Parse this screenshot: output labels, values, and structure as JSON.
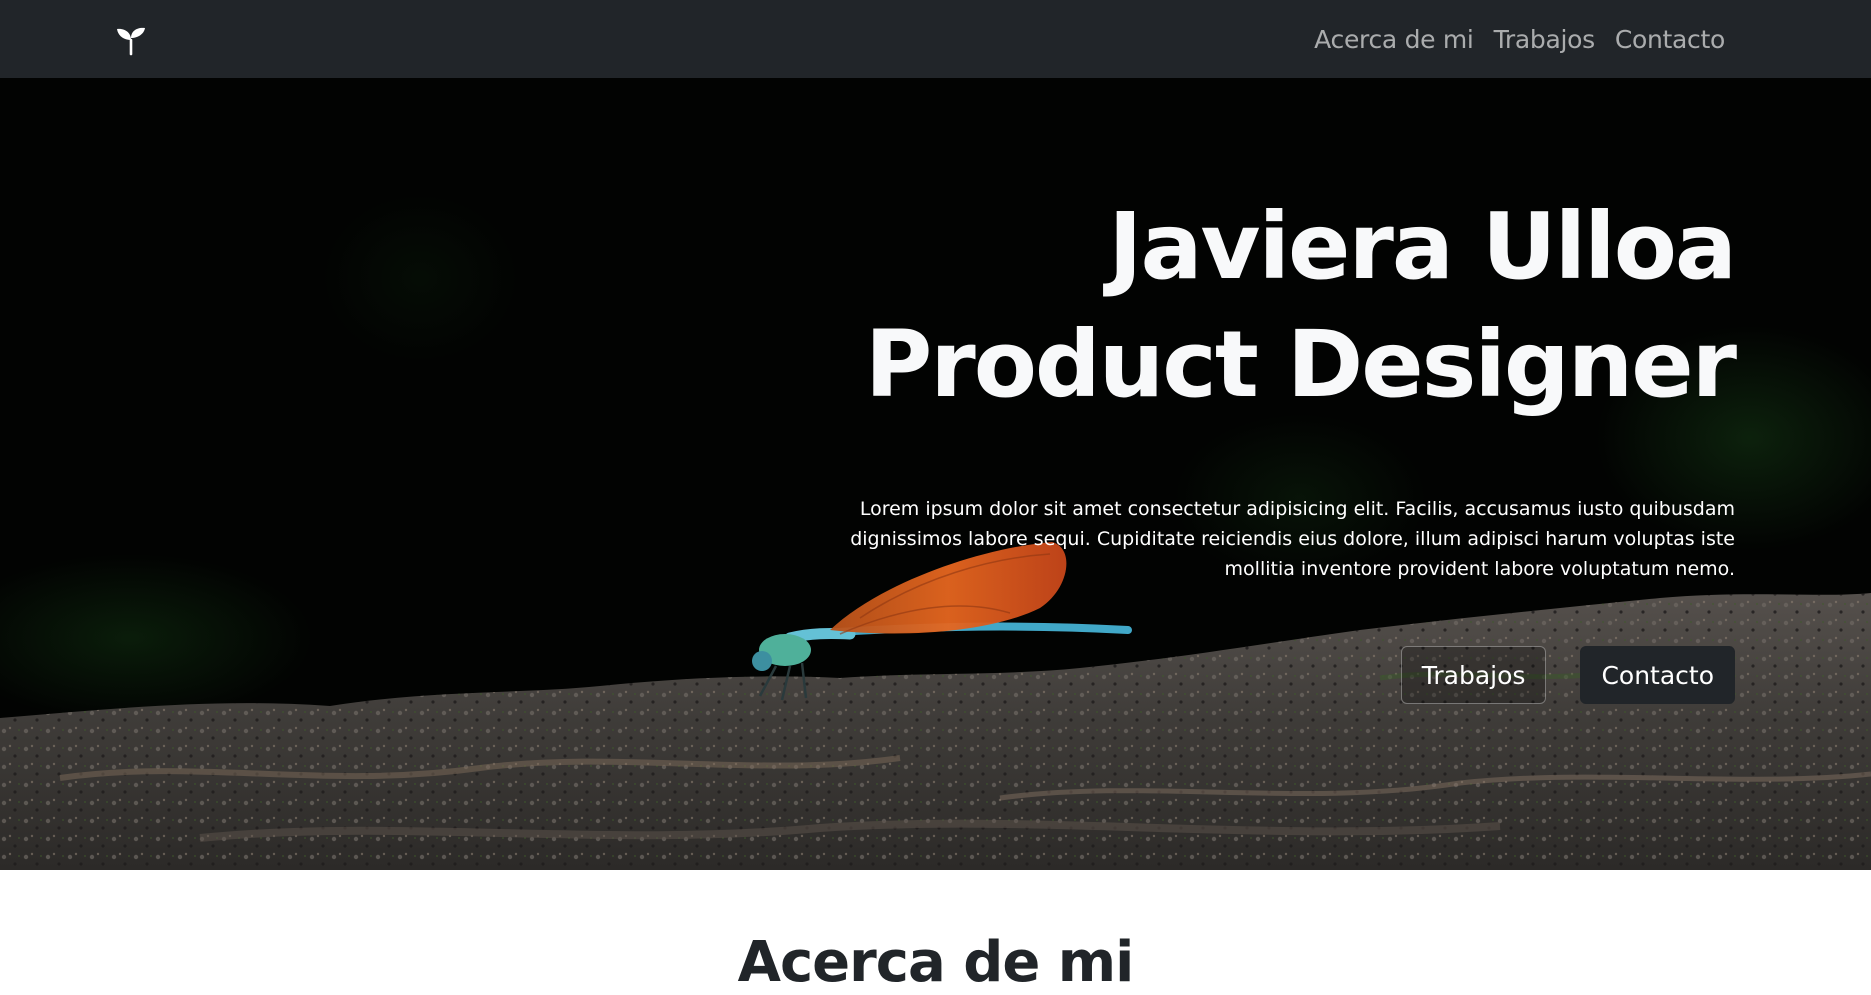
{
  "nav": {
    "brand_icon": "sprout-icon",
    "links": [
      "Acerca de mi",
      "Trabajos",
      "Contacto"
    ]
  },
  "hero": {
    "title_line1": "Javiera Ulloa",
    "title_line2": "Product Designer",
    "text": "Lorem ipsum dolor sit amet consectetur adipisicing elit. Facilis, accusamus iusto quibusdam dignissimos labore sequi. Cupiditate reiciendis eius dolore, illum adipisci harum voluptas iste mollitia inventore provident labore voluptatum nemo.",
    "button_primary": "Trabajos",
    "button_secondary": "Contacto"
  },
  "next_section": {
    "title": "Acerca de mi"
  },
  "colors": {
    "navbar": "#212529",
    "hero_bg": "#020302",
    "button_dark": "#212529"
  }
}
